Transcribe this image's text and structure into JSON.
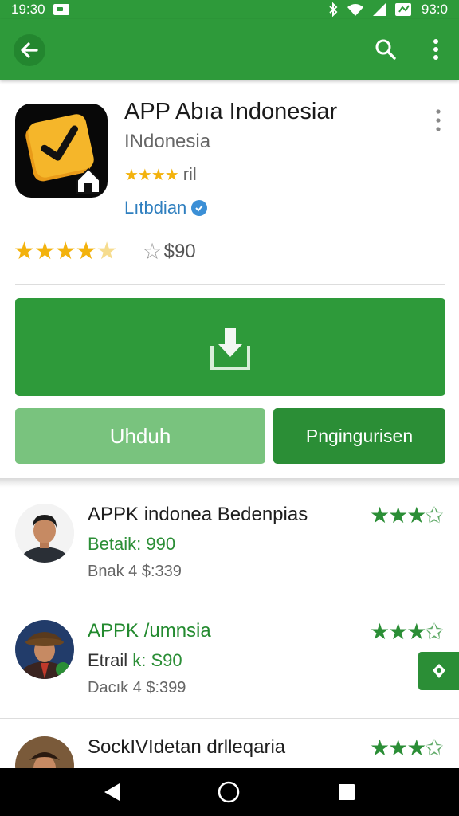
{
  "status_bar": {
    "time_left": "19:30",
    "time_right": "93:0"
  },
  "app": {
    "title": "APP Abıa Indonesiar",
    "subtitle": "INdonesia",
    "small_rating_text": "ril",
    "developer": "Lıtbdian",
    "rating_count": "$90",
    "icon_name": "checkmark-app-icon"
  },
  "buttons": {
    "primary_icon": "download-icon",
    "unduh_label": "Uhduh",
    "uninstall_label": "Pngingurisen"
  },
  "list": [
    {
      "title": "APPK indonea Bedenpias",
      "line2_label": "Betaik:",
      "line2_value": "990",
      "line3": "Bnak 4 $:339",
      "rating": 4
    },
    {
      "title": "APPK /umnsia",
      "line2_label": "Etrail",
      "line2_value": "k: S90",
      "line3": "Dacık 4 $:399",
      "rating": 4
    },
    {
      "title": "SockIVIdetan drlleqaria",
      "rating": 4
    }
  ],
  "colors": {
    "brand_green": "#2e9a3a",
    "star_gold": "#f3b20c",
    "light_green": "#79c37e",
    "link_blue": "#2f7fbf"
  }
}
